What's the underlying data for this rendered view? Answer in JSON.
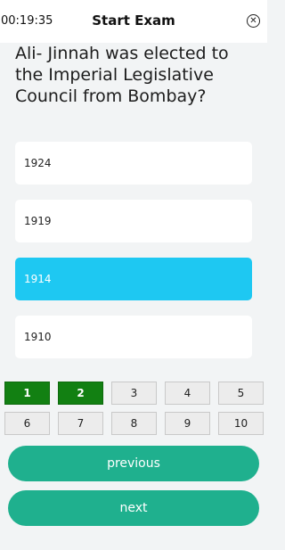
{
  "header": {
    "timer": "00:19:35",
    "title": "Start Exam",
    "close_icon": "close-circle-icon"
  },
  "question": {
    "text": "Ali- Jinnah was elected to the Imperial Legislative Council from Bombay?"
  },
  "options": [
    {
      "label": "1924",
      "selected": false
    },
    {
      "label": "1919",
      "selected": false
    },
    {
      "label": "1914",
      "selected": true
    },
    {
      "label": "1910",
      "selected": false
    }
  ],
  "question_numbers": [
    {
      "label": "1",
      "answered": true
    },
    {
      "label": "2",
      "answered": true
    },
    {
      "label": "3",
      "answered": false
    },
    {
      "label": "4",
      "answered": false
    },
    {
      "label": "5",
      "answered": false
    },
    {
      "label": "6",
      "answered": false
    },
    {
      "label": "7",
      "answered": false
    },
    {
      "label": "8",
      "answered": false
    },
    {
      "label": "9",
      "answered": false
    },
    {
      "label": "10",
      "answered": false
    }
  ],
  "navigation": {
    "previous_label": "previous",
    "next_label": "next"
  },
  "colors": {
    "selected_option": "#1ec8f2",
    "answered_number": "#128012",
    "nav_button": "#1fb08e"
  }
}
